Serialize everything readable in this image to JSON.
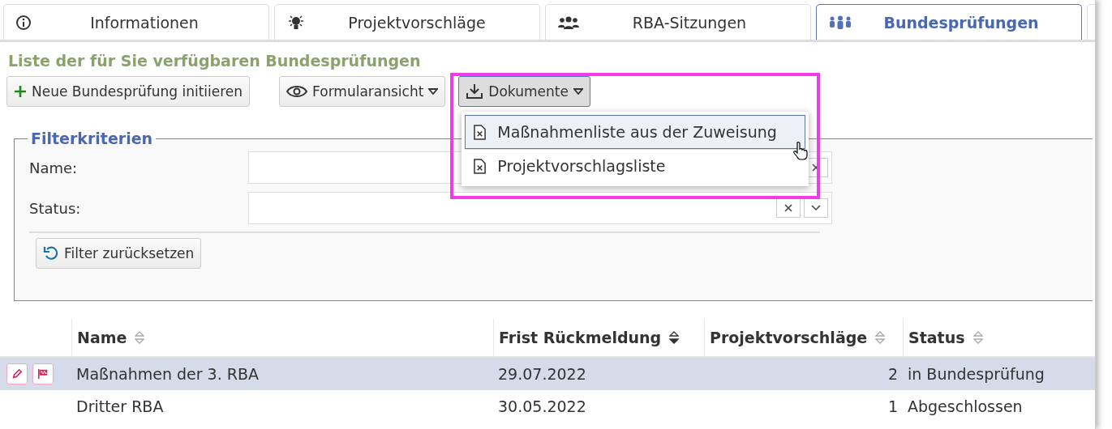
{
  "tabs": [
    {
      "label": "Informationen",
      "selected": false
    },
    {
      "label": "Projektvorschläge",
      "selected": false
    },
    {
      "label": "RBA-Sitzungen",
      "selected": false
    },
    {
      "label": "Bundesprüfungen",
      "selected": true
    }
  ],
  "heading": "Liste der für Sie verfügbaren Bundesprüfungen",
  "toolbar": [
    {
      "label": "Neue Bundesprüfung initiieren",
      "dropdown": false,
      "pressed": false
    },
    {
      "label": "Formularansicht",
      "dropdown": true,
      "pressed": false
    },
    {
      "label": "Dokumente",
      "dropdown": true,
      "pressed": true
    }
  ],
  "menu": {
    "items": [
      {
        "label": "Maßnahmenliste aus der Zuweisung",
        "hovered": true
      },
      {
        "label": "Projektvorschlagsliste",
        "hovered": false
      }
    ]
  },
  "filter": {
    "title": "Filterkriterien",
    "fields": [
      {
        "label": "Name:",
        "kind": "text"
      },
      {
        "label": "Status:",
        "kind": "select"
      }
    ],
    "reset": "Filter zurücksetzen"
  },
  "table": {
    "columns": [
      {
        "label": "Name",
        "sorted": false
      },
      {
        "label": "Frist Rückmeldung",
        "sorted": true
      },
      {
        "label": "Projektvorschläge",
        "sorted": false
      },
      {
        "label": "Status",
        "sorted": false
      }
    ],
    "rows": [
      {
        "cells": [
          "Maßnahmen der 3. RBA",
          "29.07.2022",
          "2",
          "in Bundesprüfung"
        ],
        "selected": true
      },
      {
        "cells": [
          "Dritter RBA",
          "30.05.2022",
          "1",
          "Abgeschlossen"
        ],
        "selected": false
      }
    ]
  }
}
